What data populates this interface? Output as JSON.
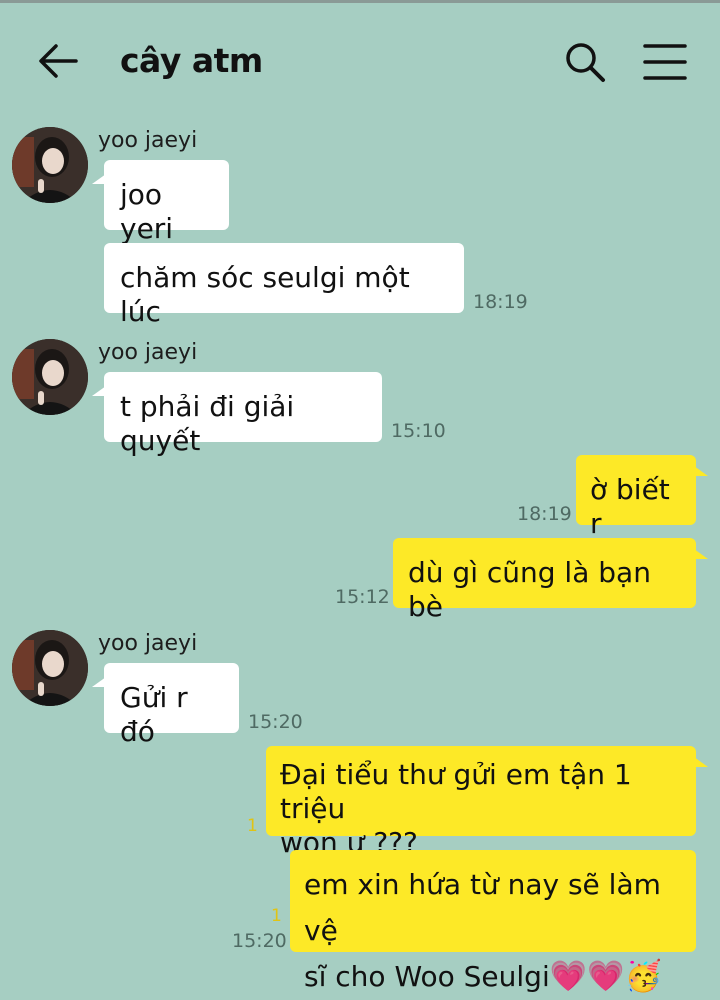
{
  "header": {
    "title": "cây atm",
    "back_icon": "arrow-left-icon",
    "search_icon": "search-icon",
    "menu_icon": "hamburger-menu-icon"
  },
  "messages": [
    {
      "sender": "yoo jaeyi",
      "text": "joo yeri"
    },
    {
      "text": "chăm sóc seulgi một lúc",
      "time": "18:19"
    },
    {
      "sender": "yoo jaeyi",
      "text": "t phải đi giải quyết",
      "time": "15:10"
    },
    {
      "text": "ờ biết r",
      "time": "18:19"
    },
    {
      "text": "dù gì cũng là bạn bè",
      "time": "15:12"
    },
    {
      "sender": "yoo jaeyi",
      "text": "Gửi r đó",
      "time": "15:20"
    },
    {
      "text_line1": "Đại tiểu thư gửi em tận 1 triệu",
      "text_line2": "won ư ???",
      "unread": "1"
    },
    {
      "text_line1": "em xin hứa từ nay sẽ làm vệ",
      "text_line2": "sĩ cho Woo Seulgi",
      "emoji": "💗💗🥳",
      "unread": "1",
      "time": "15:20"
    }
  ],
  "colors": {
    "background": "#a6cec2",
    "outgoing_bubble": "#fde927",
    "incoming_bubble": "#ffffff"
  }
}
